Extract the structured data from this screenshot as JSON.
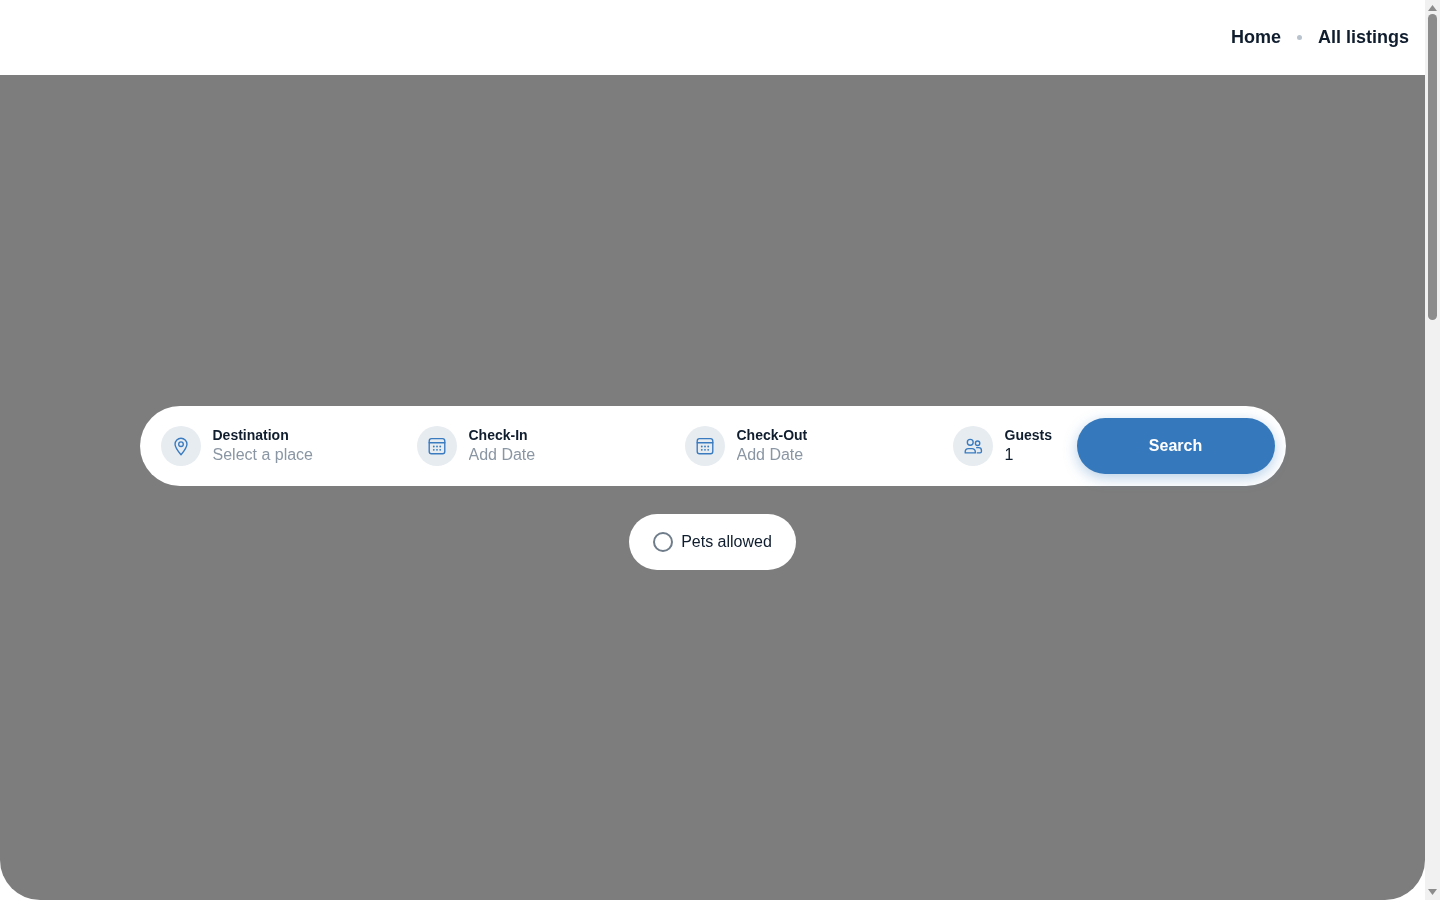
{
  "header": {
    "nav": [
      {
        "label": "Home"
      },
      {
        "label": "All listings"
      }
    ]
  },
  "search_bar": {
    "fields": [
      {
        "kind": "place",
        "label": "Destination",
        "placeholder": "Select a place"
      },
      {
        "kind": "date",
        "label": "Check-In",
        "placeholder": "Add Date"
      },
      {
        "kind": "date",
        "label": "Check-Out",
        "placeholder": "Add Date"
      },
      {
        "kind": "guests",
        "label": "Guests",
        "value": "1"
      }
    ],
    "button": "Search"
  },
  "filters": [
    {
      "label": "Pets allowed",
      "checked": false
    }
  ]
}
